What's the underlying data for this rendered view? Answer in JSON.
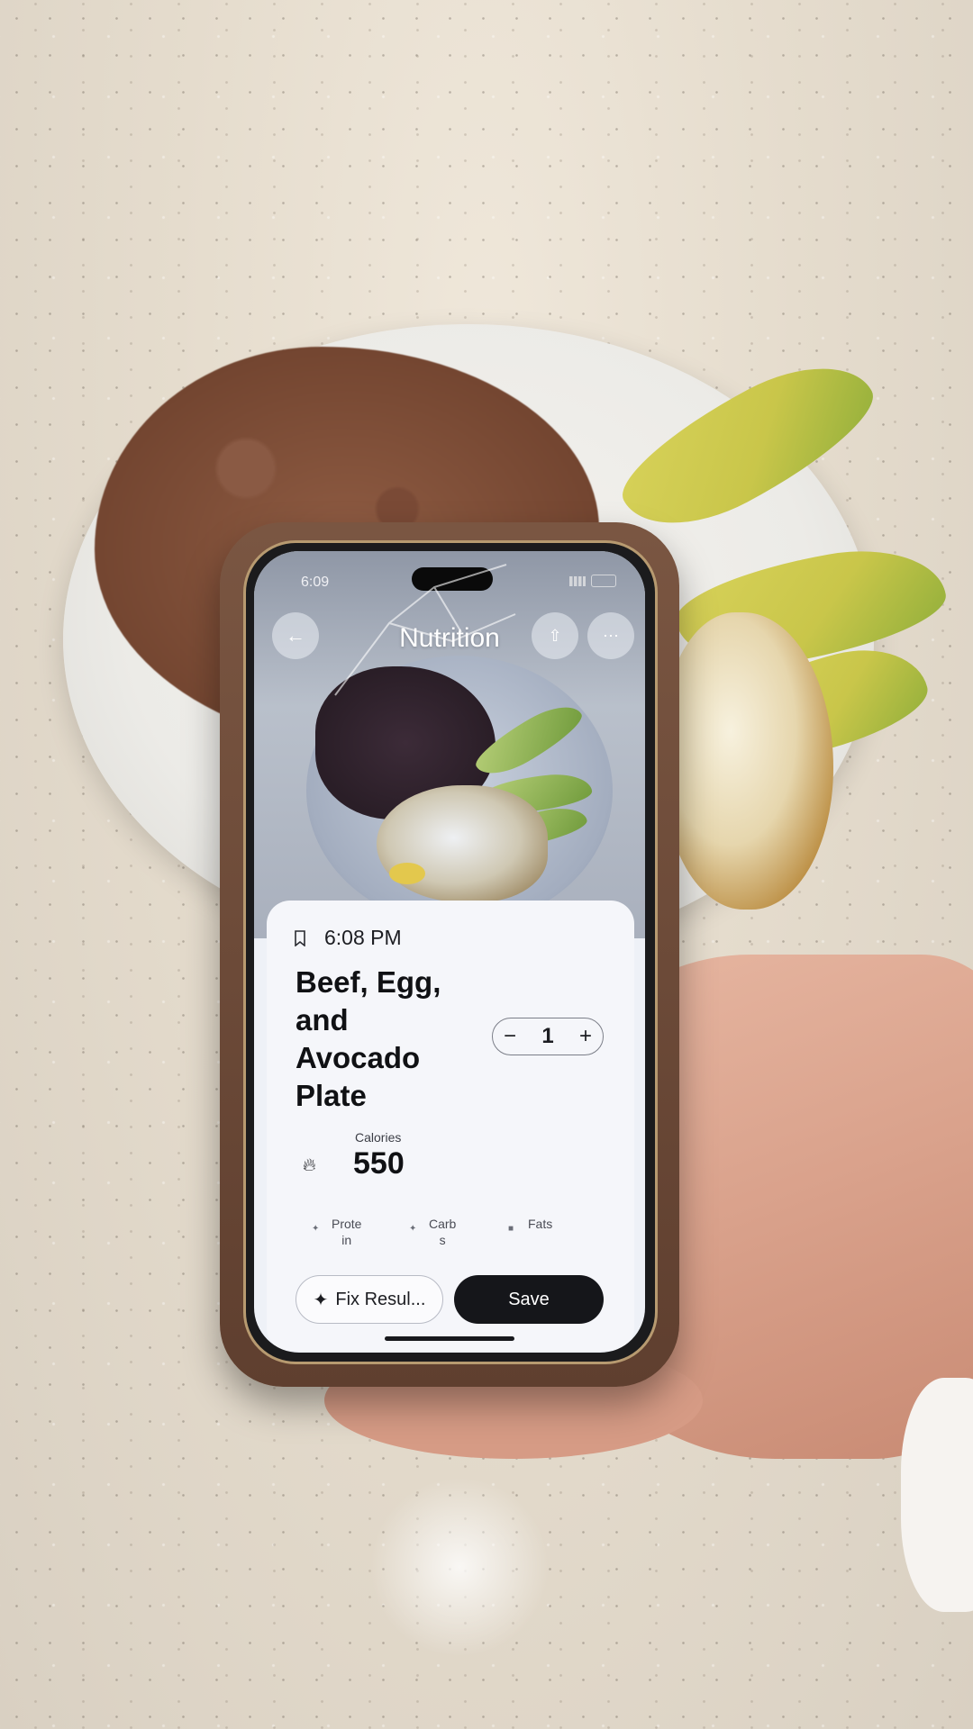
{
  "status_bar": {
    "time": "6:09"
  },
  "app": {
    "title": "Nutrition",
    "header_buttons": [
      "back-icon",
      "share-icon",
      "more-icon"
    ]
  },
  "entry": {
    "time": "6:08 PM",
    "title_lines": [
      "Beef, Egg,",
      "and",
      "Avocado",
      "Plate"
    ],
    "quantity": "1",
    "minus_symbol": "−",
    "plus_symbol": "+",
    "calories_label": "Calories",
    "calories_value": "550",
    "macros": [
      {
        "label": "Prote\nin",
        "icon": "protein-icon"
      },
      {
        "label": "Carb\ns",
        "icon": "carbs-icon"
      },
      {
        "label": "Fats",
        "icon": "fats-icon"
      }
    ]
  },
  "actions": {
    "fix_label": "Fix Resul...",
    "save_label": "Save"
  },
  "colors": {
    "sheet_bg": "#f5f6fa",
    "primary_button": "#15161a",
    "nail_polish": "#c8161f"
  }
}
